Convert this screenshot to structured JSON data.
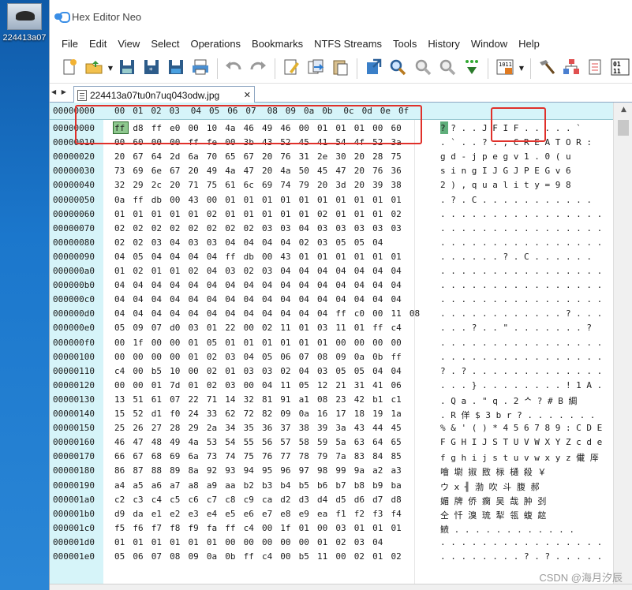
{
  "desktop": {
    "icon_label": "224413a07"
  },
  "window": {
    "title": "Hex Editor Neo"
  },
  "menu": [
    "File",
    "Edit",
    "View",
    "Select",
    "Operations",
    "Bookmarks",
    "NTFS Streams",
    "Tools",
    "History",
    "Window",
    "Help"
  ],
  "toolbar": [
    {
      "name": "new-file",
      "icon": "new-file-icon"
    },
    {
      "name": "open-file",
      "icon": "open-folder-icon",
      "dropdown": true
    },
    {
      "name": "save",
      "icon": "save-icon"
    },
    {
      "name": "save-all",
      "icon": "save-all-icon"
    },
    {
      "name": "save-as",
      "icon": "save-as-icon"
    },
    {
      "name": "print",
      "icon": "print-icon"
    },
    {
      "name": "undo",
      "icon": "undo-icon"
    },
    {
      "name": "redo",
      "icon": "redo-icon"
    },
    {
      "name": "edit",
      "icon": "edit-icon"
    },
    {
      "name": "copy",
      "icon": "copy-icon"
    },
    {
      "name": "paste",
      "icon": "paste-icon"
    },
    {
      "name": "export",
      "icon": "export-icon"
    },
    {
      "name": "find",
      "icon": "find-icon"
    },
    {
      "name": "find-next",
      "icon": "find-next-icon"
    },
    {
      "name": "find-prev",
      "icon": "find-prev-icon"
    },
    {
      "name": "replace",
      "icon": "replace-icon"
    },
    {
      "name": "encoding",
      "icon": "encoding-icon",
      "dropdown": true
    },
    {
      "name": "tool-a",
      "icon": "hammer-icon"
    },
    {
      "name": "structure",
      "icon": "structure-icon"
    },
    {
      "name": "compare",
      "icon": "compare-icon"
    },
    {
      "name": "binary",
      "icon": "binary-icon"
    }
  ],
  "tab": {
    "filename": "224413a07tu0n7uq043odw.jpg",
    "close": "✕",
    "nav": "◀ ▶"
  },
  "hex": {
    "header_addr": "00000000",
    "header_bytes": [
      "00",
      "01",
      "02",
      "03",
      "04",
      "05",
      "06",
      "07",
      "08",
      "09",
      "0a",
      "0b",
      "0c",
      "0d",
      "0e",
      "0f"
    ],
    "rows": [
      {
        "addr": "00000000",
        "bytes": "ff d8 ff e0 00 10 4a 46 49 46 00 01 01 01 00 60",
        "ascii": "? ? . . J F I F . . . . . `"
      },
      {
        "addr": "00000010",
        "bytes": "00 60 00 00 ff fe 00 3b 43 52 45 41 54 4f 52 3a",
        "ascii": ". ` . .   ? . ; C R E A T O R :"
      },
      {
        "addr": "00000020",
        "bytes": "20 67 64 2d 6a 70 65 67 20 76 31 2e 30 20 28 75",
        "ascii": "  g d - j p e g   v 1 . 0   ( u"
      },
      {
        "addr": "00000030",
        "bytes": "73 69 6e 67 20 49 4a 47 20 4a 50 45 47 20 76 36",
        "ascii": "s i n g   I J G   J P E G   v 6"
      },
      {
        "addr": "00000040",
        "bytes": "32 29 2c 20 71 75 61 6c 69 74 79 20 3d 20 39 38",
        "ascii": "2 ) ,   q u a l i t y   =   9 8"
      },
      {
        "addr": "00000050",
        "bytes": "0a ff db 00 43 00 01 01 01 01 01 01 01 01 01 01",
        "ascii": ".   ? . C . . . . . . . . . . ."
      },
      {
        "addr": "00000060",
        "bytes": "01 01 01 01 01 02 01 01 01 01 01 02 01 01 01 02",
        "ascii": ". . . . . . . . . . . . . . . ."
      },
      {
        "addr": "00000070",
        "bytes": "02 02 02 02 02 02 02 02 03 03 04 03 03 03 03 03",
        "ascii": ". . . . . . . . . . . . . . . ."
      },
      {
        "addr": "00000080",
        "bytes": "02 02 03 04 03 03 04 04 04 04 02 03 05 05 04",
        "ascii": ". . . . . . . . . . . . . . . ."
      },
      {
        "addr": "00000090",
        "bytes": "04 05 04 04 04 04 ff db 00 43 01 01 01 01 01 01",
        "ascii": ". . . . . .   ? . C . . . . . ."
      },
      {
        "addr": "000000a0",
        "bytes": "01 02 01 01 02 04 03 02 03 04 04 04 04 04 04 04",
        "ascii": ". . . . . . . . . . . . . . . ."
      },
      {
        "addr": "000000b0",
        "bytes": "04 04 04 04 04 04 04 04 04 04 04 04 04 04 04 04",
        "ascii": ". . . . . . . . . . . . . . . ."
      },
      {
        "addr": "000000c0",
        "bytes": "04 04 04 04 04 04 04 04 04 04 04 04 04 04 04 04",
        "ascii": ". . . . . . . . . . . . . . . ."
      },
      {
        "addr": "000000d0",
        "bytes": "04 04 04 04 04 04 04 04 04 04 04 04 ff c0 00 11 08",
        "ascii": ". . . . . . . . . . . .   ? . . ."
      },
      {
        "addr": "000000e0",
        "bytes": "05 09 07 d0 03 01 22 00 02 11 01 03 11 01 ff c4",
        "ascii": ". . . ? . . \" . . . . . . .   ?"
      },
      {
        "addr": "000000f0",
        "bytes": "00 1f 00 00 01 05 01 01 01 01 01 01 00 00 00 00",
        "ascii": ". . . . . . . . . . . . . . . ."
      },
      {
        "addr": "00000100",
        "bytes": "00 00 00 00 01 02 03 04 05 06 07 08 09 0a 0b ff",
        "ascii": ". . . . . . . . . . . . . . . ."
      },
      {
        "addr": "00000110",
        "bytes": "c4 00 b5 10 00 02 01 03 03 02 04 03 05 05 04 04",
        "ascii": "? . ? . . . . . . . . . . . . ."
      },
      {
        "addr": "00000120",
        "bytes": "00 00 01 7d 01 02 03 00 04 11 05 12 21 31 41 06",
        "ascii": ". . . } . . . . . . . . ! 1 A ."
      },
      {
        "addr": "00000130",
        "bytes": "13 51 61 07 22 71 14 32 81 91 a1 08 23 42 b1 c1",
        "ascii": ". Q a . \" q . 2 ᄉ  ?   # B 綢"
      },
      {
        "addr": "00000140",
        "bytes": "15 52 d1 f0 24 33 62 72 82 09 0a 16 17 18 19 1a",
        "ascii": ". R 佯 $ 3 b r ? . . . . . . ."
      },
      {
        "addr": "00000150",
        "bytes": "25 26 27 28 29 2a 34 35 36 37 38 39 3a 43 44 45",
        "ascii": "% & ' ( ) * 4 5 6 7 8 9 : C D E"
      },
      {
        "addr": "00000160",
        "bytes": "46 47 48 49 4a 53 54 55 56 57 58 59 5a 63 64 65",
        "ascii": "F G H I J S T U V W X Y Z c d e"
      },
      {
        "addr": "00000170",
        "bytes": "66 67 68 69 6a 73 74 75 76 77 78 79 7a 83 84 85",
        "ascii": "f g h i j s t u v w x y z 儎 厗"
      },
      {
        "addr": "00000180",
        "bytes": "86 87 88 89 8a 92 93 94 95 96 97 98 99 9a a2 a3",
        "ascii": "  噲 墛 掓 敃 柡 樋 殺 ￥"
      },
      {
        "addr": "00000190",
        "bytes": "a4 a5 a6 a7 a8 a9 aa b2 b3 b4 b5 b6 b7 b8 b9 ba",
        "ascii": "  ウ ⅹ ╢ 渤 吹 斗 腹 郝"
      },
      {
        "addr": "000001a0",
        "bytes": "c2 c3 c4 c5 c6 c7 c8 c9 ca d2 d3 d4 d5 d6 d7 d8",
        "ascii": "  媚 牌 侨 瘸 吴 哉 肿 刭"
      },
      {
        "addr": "000001b0",
        "bytes": "d9 da e1 e2 e3 e4 e5 e6 e7 e8 e9 ea f1 f2 f3 f4",
        "ascii": "  仝 忏 溴 琉 犁 瓴 蝮 趑"
      },
      {
        "addr": "000001c0",
        "bytes": "f5 f6 f7 f8 f9 fa ff c4 00 1f 01 00 03 01 01 01",
        "ascii": "  鲼 . . . . . . . . . . . ."
      },
      {
        "addr": "000001d0",
        "bytes": "01 01 01 01 01 01 00 00 00 00 00 01 02 03 04",
        "ascii": ". . . . . . . . . . . . . . . ."
      },
      {
        "addr": "000001e0",
        "bytes": "05 06 07 08 09 0a 0b ff c4 00 b5 11 00 02 01 02",
        "ascii": ". . . . . . . . ? . ? . . . . ."
      }
    ]
  },
  "watermark": "CSDN @海月汐辰",
  "colors": {
    "address_bg": "#d6f4f9",
    "cursor": "#8ec88e",
    "annotation": "#e0302a",
    "window_bg": "#ffffff"
  }
}
